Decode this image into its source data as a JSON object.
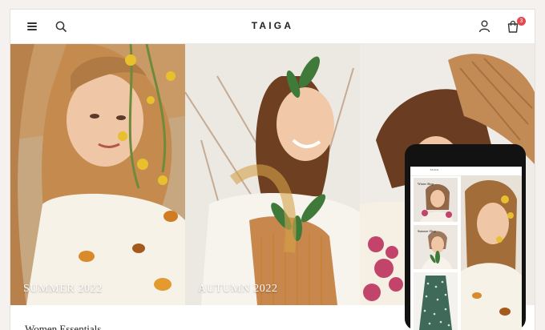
{
  "header": {
    "brand": "TAIGA",
    "cart_count": "3",
    "icons": [
      "hamburger-menu-icon",
      "search-icon",
      "user-icon",
      "shopping-bag-icon"
    ],
    "badge_color": "#e2484d"
  },
  "collections": [
    {
      "label": "SUMMER 2022"
    },
    {
      "label": "AUTUMN 2022"
    },
    {
      "label": ""
    }
  ],
  "section": {
    "title": "Women Essentials"
  },
  "mobile_preview": {
    "brand": "TAIGA",
    "cards": [
      {
        "label": "Winter Shop"
      },
      {
        "label": "Summer Shop"
      },
      {
        "label": ""
      }
    ]
  }
}
